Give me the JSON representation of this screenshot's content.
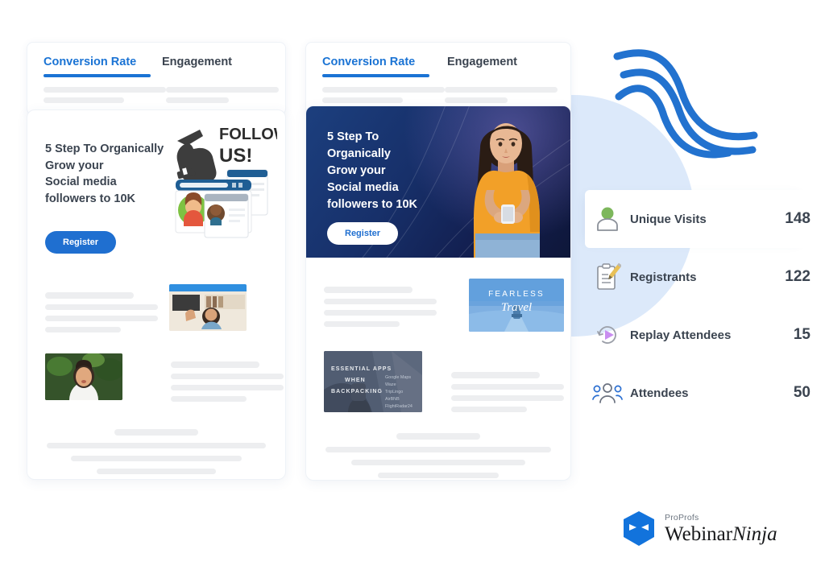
{
  "brand": {
    "accent_blue": "#1a73d4",
    "button_blue": "#1f6fd0",
    "blob_blue": "#dce9fa",
    "skeleton_gray": "#edeef0",
    "logo_sub": "ProProfs",
    "logo_main_1": "Webinar",
    "logo_main_2": "Ninja"
  },
  "cards": [
    {
      "id": "card-one",
      "tabs": [
        {
          "label": "Conversion Rate",
          "active": true
        },
        {
          "label": "Engagement",
          "active": false
        }
      ],
      "hero": {
        "title": "5 Step To Organically Grow your Social media followers to 10K",
        "title_lines": [
          "5 Step To Organically",
          "Grow your",
          "Social media",
          "followers to 10K"
        ],
        "register_label": "Register",
        "illustration": "follow-us-social-illustration",
        "illustration_text_1": "FOLLOW",
        "illustration_text_2": "US!"
      },
      "thumbs": [
        {
          "name": "webinar-speaker-bookshelf-thumb",
          "caption": ""
        },
        {
          "name": "webinar-speaker-portrait-thumb",
          "caption": ""
        }
      ]
    },
    {
      "id": "card-two",
      "tabs": [
        {
          "label": "Conversion Rate",
          "active": true
        },
        {
          "label": "Engagement",
          "active": false
        }
      ],
      "hero": {
        "title": "5 Step To Organically Grow your Social media followers to 10K",
        "title_lines": [
          "5 Step To",
          "Organically",
          "Grow your",
          "Social media",
          "followers to 10K"
        ],
        "register_label": "Register",
        "illustration": "woman-with-phone-photo"
      },
      "thumbs": [
        {
          "name": "fearless-travel-thumb",
          "line1": "FEARLESS",
          "line2": "Travel"
        },
        {
          "name": "essential-apps-backpacking-thumb",
          "line1": "ESSENTIAL APPS",
          "line2": "WHEN",
          "line3": "BACKPACKING",
          "apps": [
            "Google Maps",
            "Waze",
            "TripLingo",
            "AirBNB",
            "FlightRadar24"
          ]
        }
      ]
    }
  ],
  "stats": {
    "items": [
      {
        "icon": "user-green-icon",
        "label": "Unique Visits",
        "value": "148",
        "highlighted": true
      },
      {
        "icon": "clipboard-pencil-icon",
        "label": "Registrants",
        "value": "122",
        "highlighted": false
      },
      {
        "icon": "replay-play-icon",
        "label": "Replay Attendees",
        "value": "15",
        "highlighted": false
      },
      {
        "icon": "group-people-icon",
        "label": "Attendees",
        "value": "50",
        "highlighted": false
      }
    ]
  },
  "decor": {
    "waves": "blue-wave-lines-decoration",
    "blob": "light-blue-rounded-blob"
  }
}
